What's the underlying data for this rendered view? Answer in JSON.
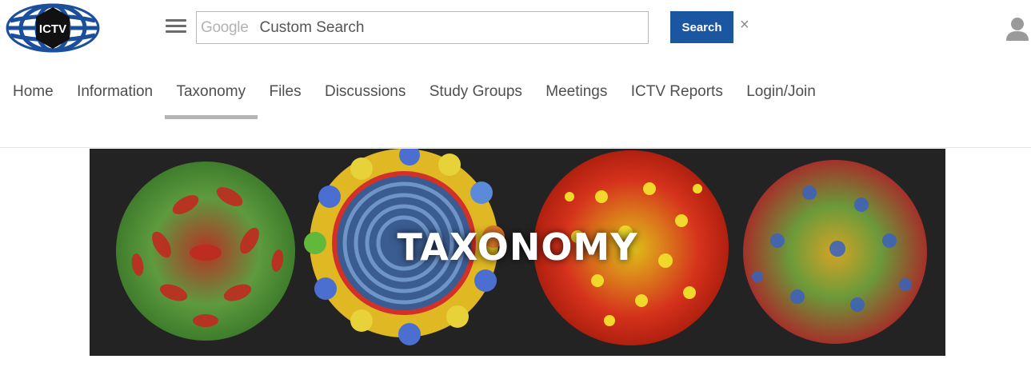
{
  "logo": {
    "text": "ICTV"
  },
  "search": {
    "brand": "Google",
    "placeholder": "Custom Search",
    "button_label": "Search",
    "close_glyph": "×"
  },
  "nav": {
    "items": [
      {
        "label": "Home"
      },
      {
        "label": "Information"
      },
      {
        "label": "Taxonomy",
        "active": true
      },
      {
        "label": "Files"
      },
      {
        "label": "Discussions"
      },
      {
        "label": "Study Groups"
      },
      {
        "label": "Meetings"
      },
      {
        "label": "ICTV Reports"
      },
      {
        "label": "Login/Join"
      }
    ]
  },
  "banner": {
    "title": "TAXONOMY"
  },
  "icons": [
    "hamburger-menu-icon",
    "user-icon",
    "close-icon"
  ],
  "colors": {
    "search_button": "#1a57a0",
    "logo_blue": "#1b4f9c",
    "banner_bg": "#232323"
  }
}
